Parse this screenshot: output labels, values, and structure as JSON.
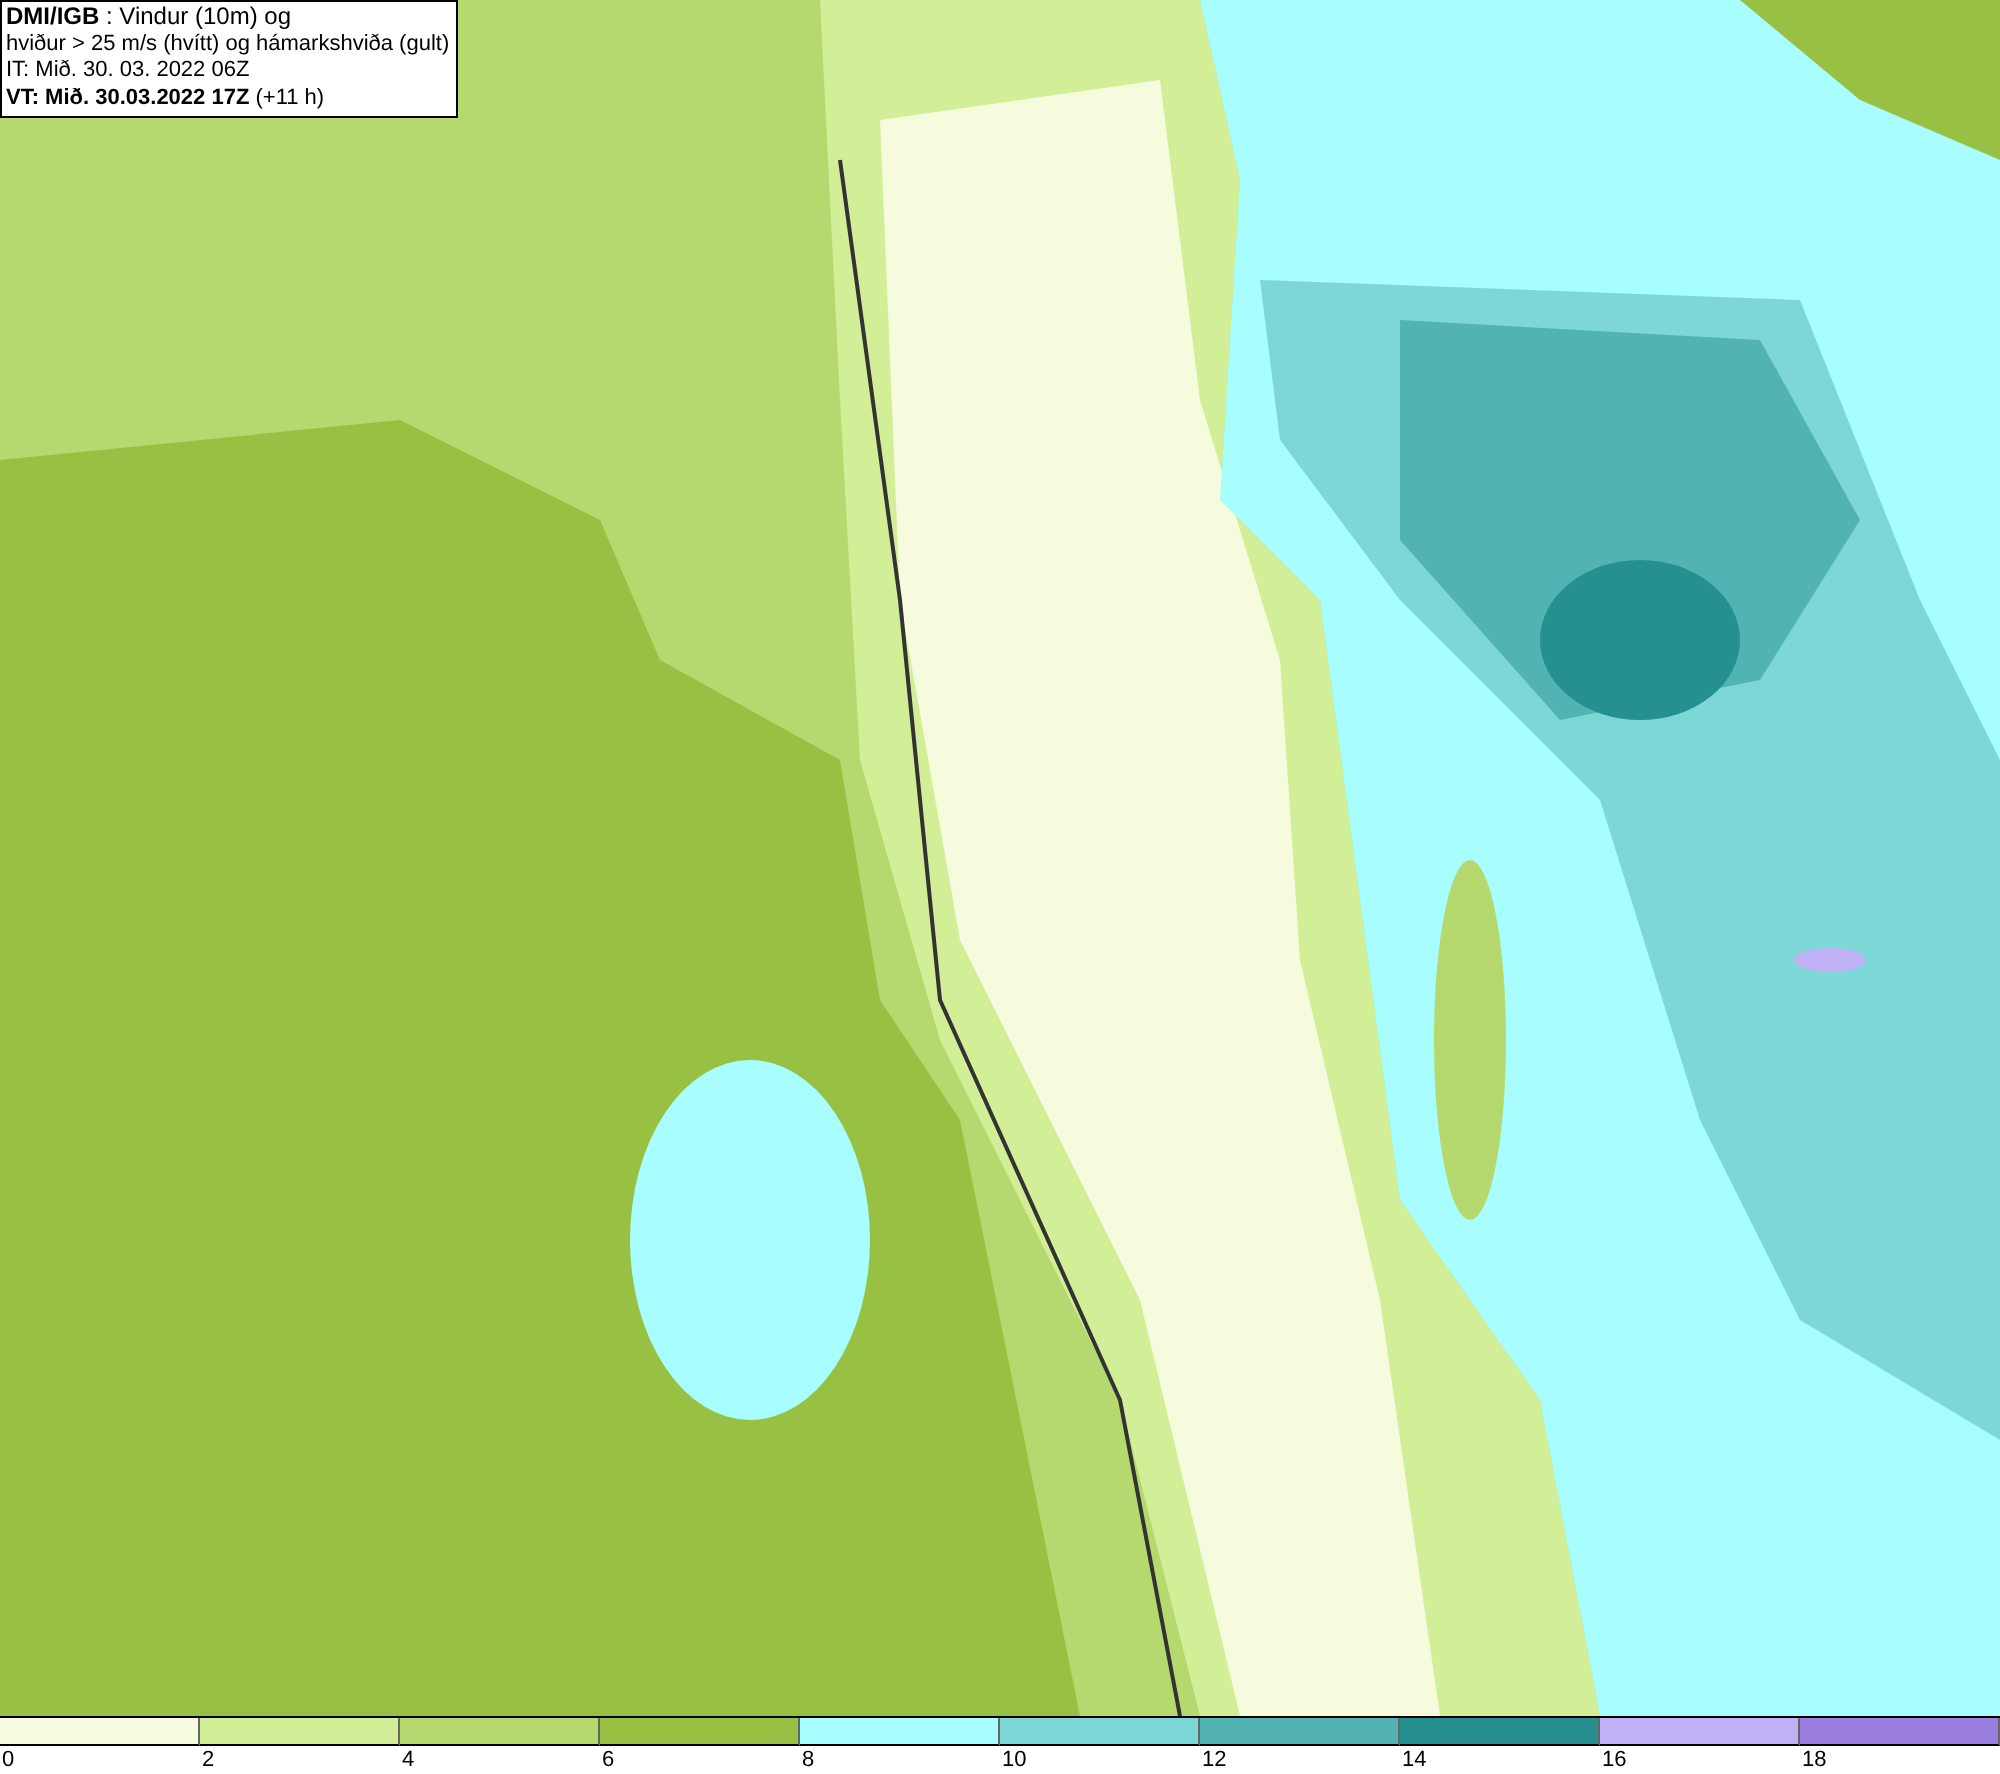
{
  "info_box": {
    "lines": [
      "**DMI/IGB** : Vindur (10m) og",
      "hviður > 25 m/s (hvítt) og hámarkshviða (gult)",
      "IT: Mið. 30. 03. 2022 06Z",
      "**VT: Mið. 30.03.2022 17Z** (+11 h)"
    ]
  },
  "legend": [
    {
      "label": "0",
      "color": "#f5fbdc"
    },
    {
      "label": "2",
      "color": "#d2ee96"
    },
    {
      "label": "4",
      "color": "#b5d96e"
    },
    {
      "label": "6",
      "color": "#98c143"
    },
    {
      "label": "8",
      "color": "#a8fefe"
    },
    {
      "label": "10",
      "color": "#7dd7d7"
    },
    {
      "label": "12",
      "color": "#52b3b3"
    },
    {
      "label": "14",
      "color": "#269090"
    },
    {
      "label": "16",
      "color": "#c0b0f6"
    },
    {
      "label": "18",
      "color": "#9a7fe0"
    }
  ]
}
